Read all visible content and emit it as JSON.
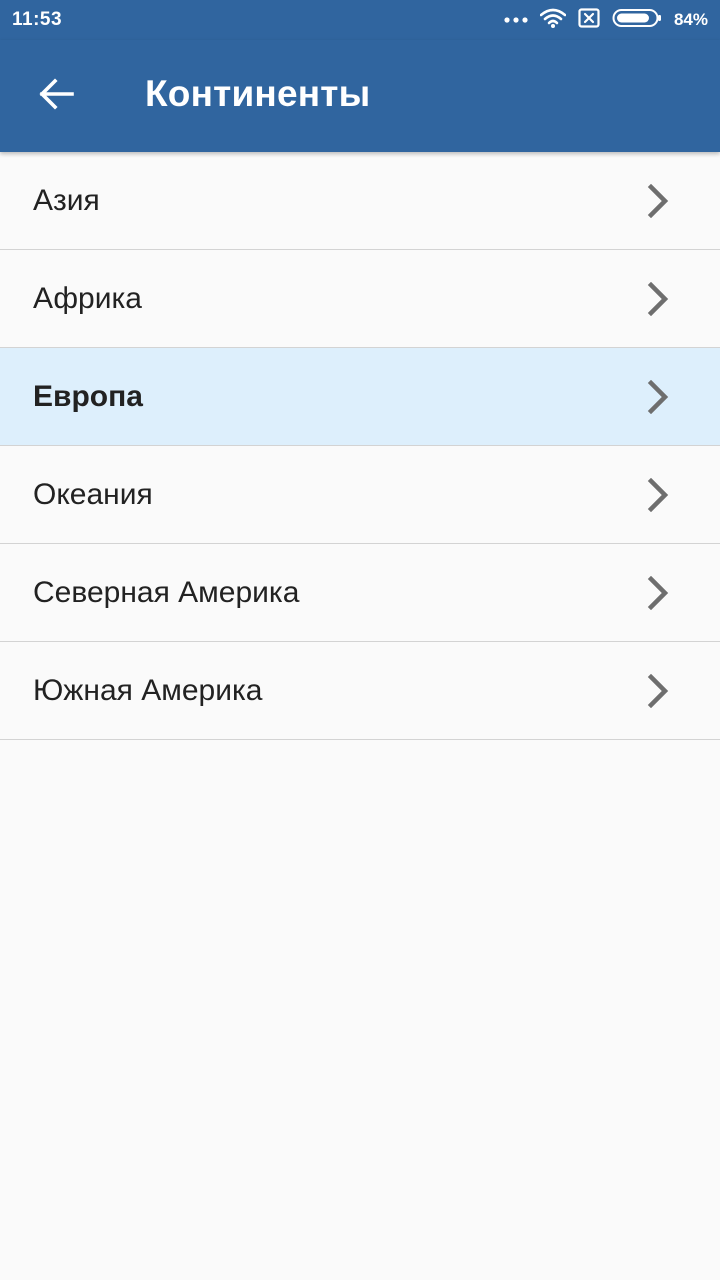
{
  "status_bar": {
    "time": "11:53",
    "battery_percent": "84%",
    "icons": [
      "more-dots-icon",
      "wifi-icon",
      "no-sim-icon",
      "battery-icon"
    ]
  },
  "app_bar": {
    "back_icon": "arrow-left-icon",
    "title": "Континенты"
  },
  "colors": {
    "primary": "#30659f",
    "selected_row": "#ddeffc",
    "background": "#fafafa",
    "divider": "#d3d3d3",
    "chevron": "#6e6e6e"
  },
  "continents": {
    "items": [
      {
        "label": "Азия",
        "selected": false
      },
      {
        "label": "Африка",
        "selected": false
      },
      {
        "label": "Европа",
        "selected": true
      },
      {
        "label": "Океания",
        "selected": false
      },
      {
        "label": "Северная Америка",
        "selected": false
      },
      {
        "label": "Южная Америка",
        "selected": false
      }
    ],
    "item_icon": "chevron-right-icon"
  }
}
